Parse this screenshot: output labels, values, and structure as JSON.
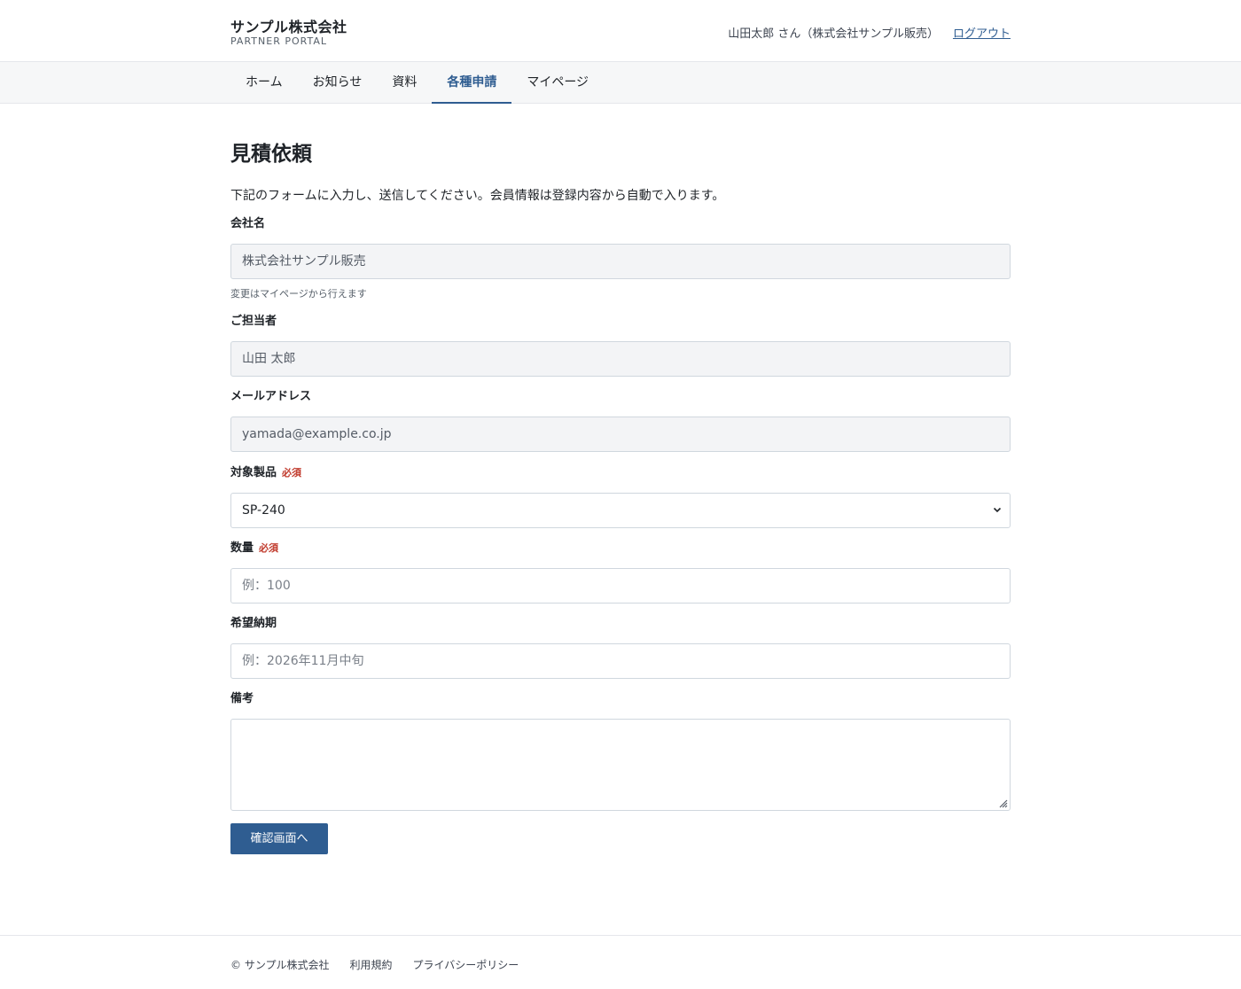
{
  "header": {
    "company": "サンプル株式会社",
    "portal_label": "PARTNER PORTAL",
    "user_text": "山田太郎 さん（株式会社サンプル販売）",
    "logout": "ログアウト"
  },
  "nav": {
    "items": [
      {
        "label": "ホーム"
      },
      {
        "label": "お知らせ"
      },
      {
        "label": "資料"
      },
      {
        "label": "各種申請",
        "active": true
      },
      {
        "label": "マイページ"
      }
    ]
  },
  "page": {
    "title": "見積依頼",
    "lead": "下記のフォームに入力し、送信してください。会員情報は登録内容から自動で入ります。"
  },
  "form": {
    "company": {
      "label": "会社名",
      "value": "株式会社サンプル販売",
      "hint": "変更はマイページから行えます"
    },
    "contact": {
      "label": "ご担当者",
      "value": "山田 太郎"
    },
    "email": {
      "label": "メールアドレス",
      "value": "yamada@example.co.jp"
    },
    "product": {
      "label": "対象製品",
      "required": "必須",
      "value": "SP-240"
    },
    "quantity": {
      "label": "数量",
      "required": "必須",
      "placeholder": "例：100"
    },
    "delivery": {
      "label": "希望納期",
      "placeholder": "例：2026年11月中旬"
    },
    "notes": {
      "label": "備考",
      "value": ""
    },
    "submit": "確認画面へ"
  },
  "footer": {
    "copyright": "© サンプル株式会社",
    "terms": "利用規約",
    "privacy": "プライバシーポリシー"
  },
  "colors": {
    "accent": "#2f5d91",
    "required": "#c0392b",
    "readonly_bg": "#f3f4f6"
  }
}
